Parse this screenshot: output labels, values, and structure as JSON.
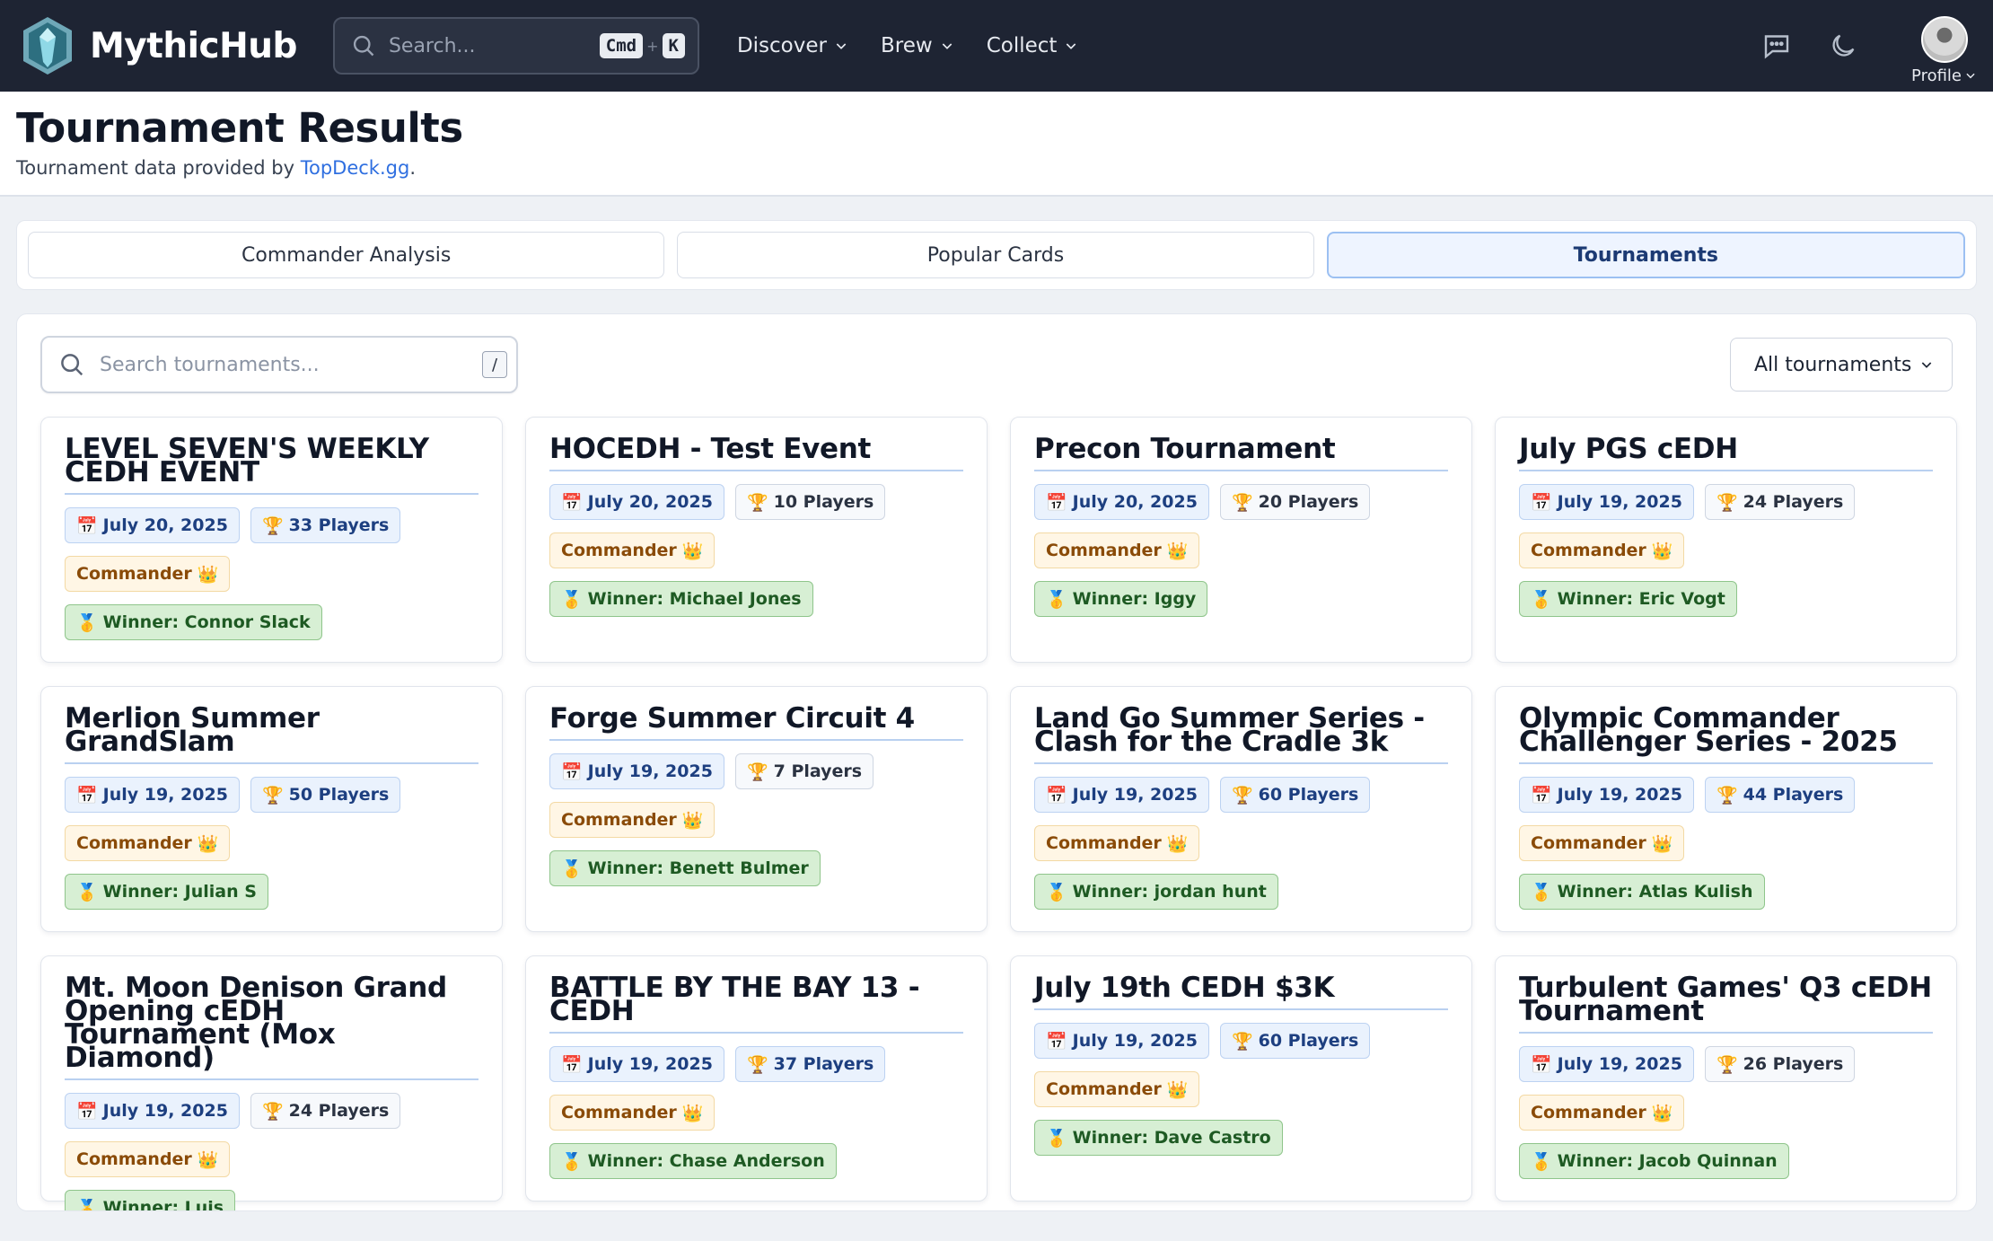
{
  "app": {
    "name": "MythicHub",
    "search_placeholder": "Search...",
    "shortcut_mod": "Cmd",
    "shortcut_plus": "+",
    "shortcut_key": "K",
    "menu": [
      "Discover",
      "Brew",
      "Collect"
    ],
    "profile_label": "Profile"
  },
  "header": {
    "title": "Tournament Results",
    "subtitle_prefix": "Tournament data provided by ",
    "subtitle_link": "TopDeck.gg",
    "subtitle_suffix": "."
  },
  "tabs": [
    {
      "label": "Commander Analysis",
      "active": false
    },
    {
      "label": "Popular Cards",
      "active": false
    },
    {
      "label": "Tournaments",
      "active": true
    }
  ],
  "filters": {
    "search_placeholder": "Search tournaments...",
    "search_shortcut": "/",
    "select_value": "All tournaments"
  },
  "icons": {
    "date": "📅",
    "players": "🏆",
    "format": "👑",
    "winner": "🥇"
  },
  "tournaments": [
    {
      "name": "LEVEL SEVEN'S WEEKLY CEDH EVENT",
      "date": "July 20, 2025",
      "players": "33 Players",
      "format": "Commander",
      "winner": "Winner: Connor Slack",
      "players_style": "blue"
    },
    {
      "name": "HOCEDH - Test Event",
      "date": "July 20, 2025",
      "players": "10 Players",
      "format": "Commander",
      "winner": "Winner: Michael Jones",
      "players_style": "plain"
    },
    {
      "name": "Precon Tournament",
      "date": "July 20, 2025",
      "players": "20 Players",
      "format": "Commander",
      "winner": "Winner: Iggy",
      "players_style": "plain"
    },
    {
      "name": "July PGS cEDH",
      "date": "July 19, 2025",
      "players": "24 Players",
      "format": "Commander",
      "winner": "Winner: Eric Vogt",
      "players_style": "plain"
    },
    {
      "name": "Merlion Summer GrandSlam",
      "date": "July 19, 2025",
      "players": "50 Players",
      "format": "Commander",
      "winner": "Winner: Julian S",
      "players_style": "blue"
    },
    {
      "name": "Forge Summer Circuit 4",
      "date": "July 19, 2025",
      "players": "7 Players",
      "format": "Commander",
      "winner": "Winner: Benett Bulmer",
      "players_style": "plain"
    },
    {
      "name": "Land Go Summer Series - Clash for the Cradle 3k",
      "date": "July 19, 2025",
      "players": "60 Players",
      "format": "Commander",
      "winner": "Winner: jordan hunt",
      "players_style": "blue"
    },
    {
      "name": "Olympic Commander Challenger Series - 2025",
      "date": "July 19, 2025",
      "players": "44 Players",
      "format": "Commander",
      "winner": "Winner: Atlas Kulish",
      "players_style": "blue"
    },
    {
      "name": "Mt. Moon Denison Grand Opening cEDH Tournament (Mox Diamond)",
      "date": "July 19, 2025",
      "players": "24 Players",
      "format": "Commander",
      "winner": "Winner: Luis",
      "players_style": "plain"
    },
    {
      "name": "BATTLE BY THE BAY 13 - CEDH",
      "date": "July 19, 2025",
      "players": "37 Players",
      "format": "Commander",
      "winner": "Winner: Chase Anderson",
      "players_style": "blue"
    },
    {
      "name": "July 19th CEDH $3K",
      "date": "July 19, 2025",
      "players": "60 Players",
      "format": "Commander",
      "winner": "Winner: Dave Castro",
      "players_style": "blue"
    },
    {
      "name": "Turbulent Games' Q3 cEDH Tournament",
      "date": "July 19, 2025",
      "players": "26 Players",
      "format": "Commander",
      "winner": "Winner: Jacob Quinnan",
      "players_style": "plain"
    }
  ]
}
